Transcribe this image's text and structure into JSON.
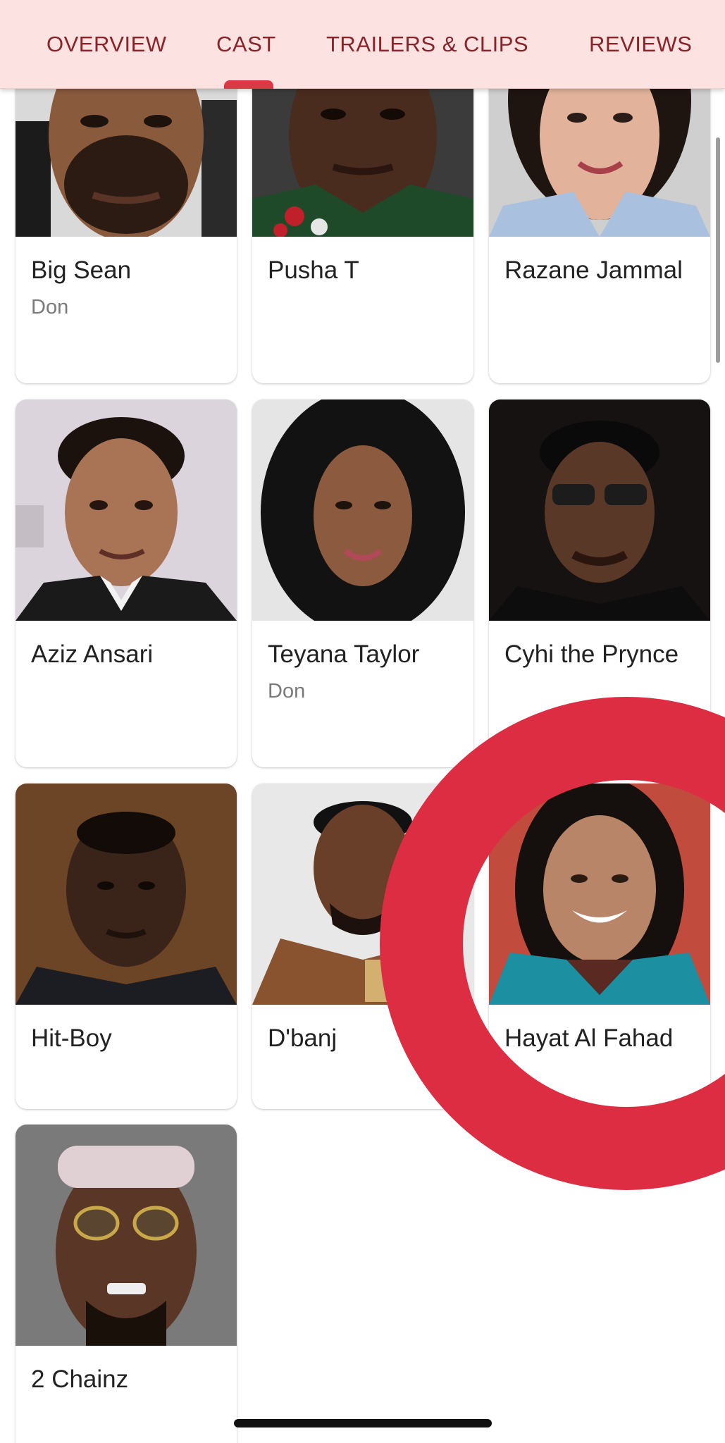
{
  "tabs": {
    "items": [
      {
        "label": "OVERVIEW"
      },
      {
        "label": "CAST"
      },
      {
        "label": "TRAILERS & CLIPS"
      },
      {
        "label": "REVIEWS"
      }
    ],
    "selected": "CAST"
  },
  "cast": [
    {
      "name": "Big Sean",
      "role": "Don"
    },
    {
      "name": "Pusha T",
      "role": ""
    },
    {
      "name": "Razane Jammal",
      "role": ""
    },
    {
      "name": "Aziz Ansari",
      "role": ""
    },
    {
      "name": "Teyana Taylor",
      "role": "Don"
    },
    {
      "name": "Cyhi the Prynce",
      "role": ""
    },
    {
      "name": "Hit-Boy",
      "role": ""
    },
    {
      "name": "D'banj",
      "role": ""
    },
    {
      "name": "Hayat Al Fahad",
      "role": ""
    },
    {
      "name": "2 Chainz",
      "role": ""
    }
  ],
  "colors": {
    "tab_bar_bg": "#fde2e2",
    "tab_text": "#8a2328",
    "tab_indicator": "#d93a44",
    "tap_ring": "#dc2d43"
  }
}
